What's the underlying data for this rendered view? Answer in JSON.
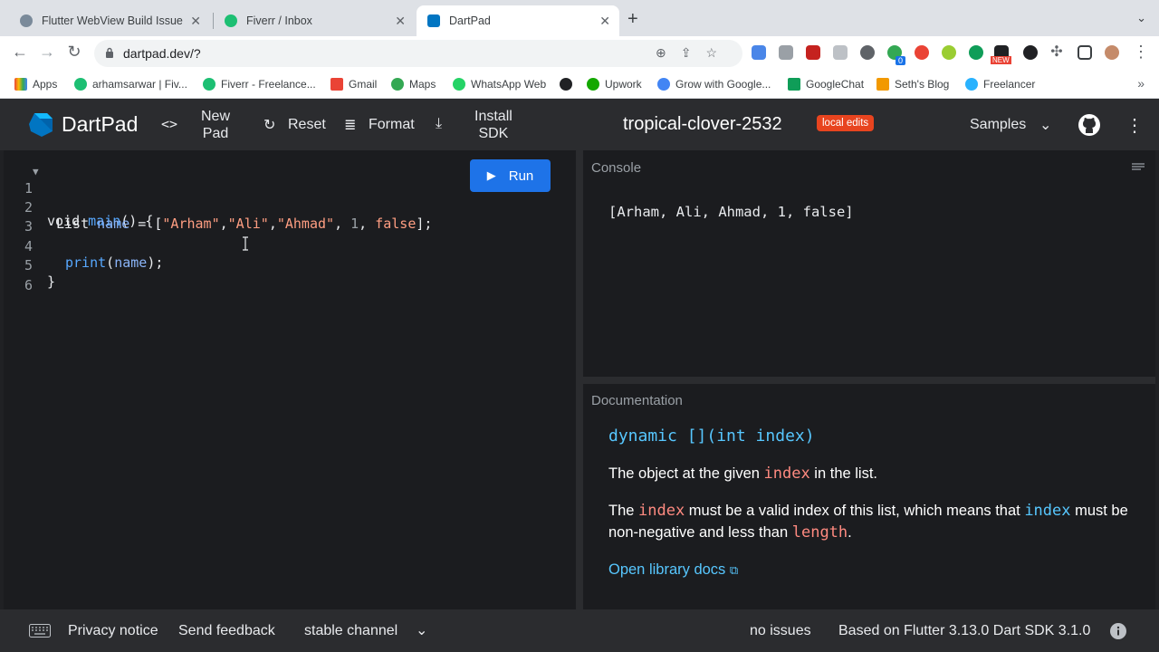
{
  "browser": {
    "tabs": [
      {
        "title": "Flutter WebView Build Issue",
        "active": false
      },
      {
        "title": "Fiverr / Inbox",
        "active": false
      },
      {
        "title": "DartPad",
        "active": true
      }
    ],
    "url": "dartpad.dev/?",
    "bookmarks": [
      "Apps",
      "arhamsarwar | Fiv...",
      "Fiverr - Freelance...",
      "Gmail",
      "Maps",
      "WhatsApp Web",
      "Upwork",
      "Grow with Google...",
      "GoogleChat",
      "Seth's Blog",
      "Freelancer"
    ],
    "extension_badge": "0",
    "new_label": "NEW"
  },
  "header": {
    "title": "DartPad",
    "new_pad": "New\nPad",
    "reset": "Reset",
    "format": "Format",
    "install_sdk": "Install\nSDK",
    "pad_name": "tropical-clover-2532",
    "badge": "local edits",
    "samples": "Samples"
  },
  "editor": {
    "line_numbers": [
      "1",
      "2",
      "3",
      "4",
      "5",
      "6"
    ],
    "run_label": "Run"
  },
  "console": {
    "label": "Console",
    "output": "[Arham, Ali, Ahmad, 1, false]"
  },
  "docs": {
    "label": "Documentation",
    "signature": "dynamic [](int index)",
    "p1_pre": "The object at the given ",
    "p1_code": "index",
    "p1_post": " in the list.",
    "p2_a": "The ",
    "p2_code1": "index",
    "p2_b": " must be a valid index of this list, which means that ",
    "p2_code2": "index",
    "p2_c": " must be non-negative and less than ",
    "p2_code3": "length",
    "p2_d": ".",
    "link": "Open library docs"
  },
  "footer": {
    "privacy": "Privacy notice",
    "feedback": "Send feedback",
    "channel": "stable channel",
    "issues": "no issues",
    "version": "Based on Flutter 3.13.0 Dart SDK 3.1.0"
  },
  "colors": {
    "run": "#1e73e8",
    "badge": "#e8441f",
    "accent": "#57c7ff"
  }
}
